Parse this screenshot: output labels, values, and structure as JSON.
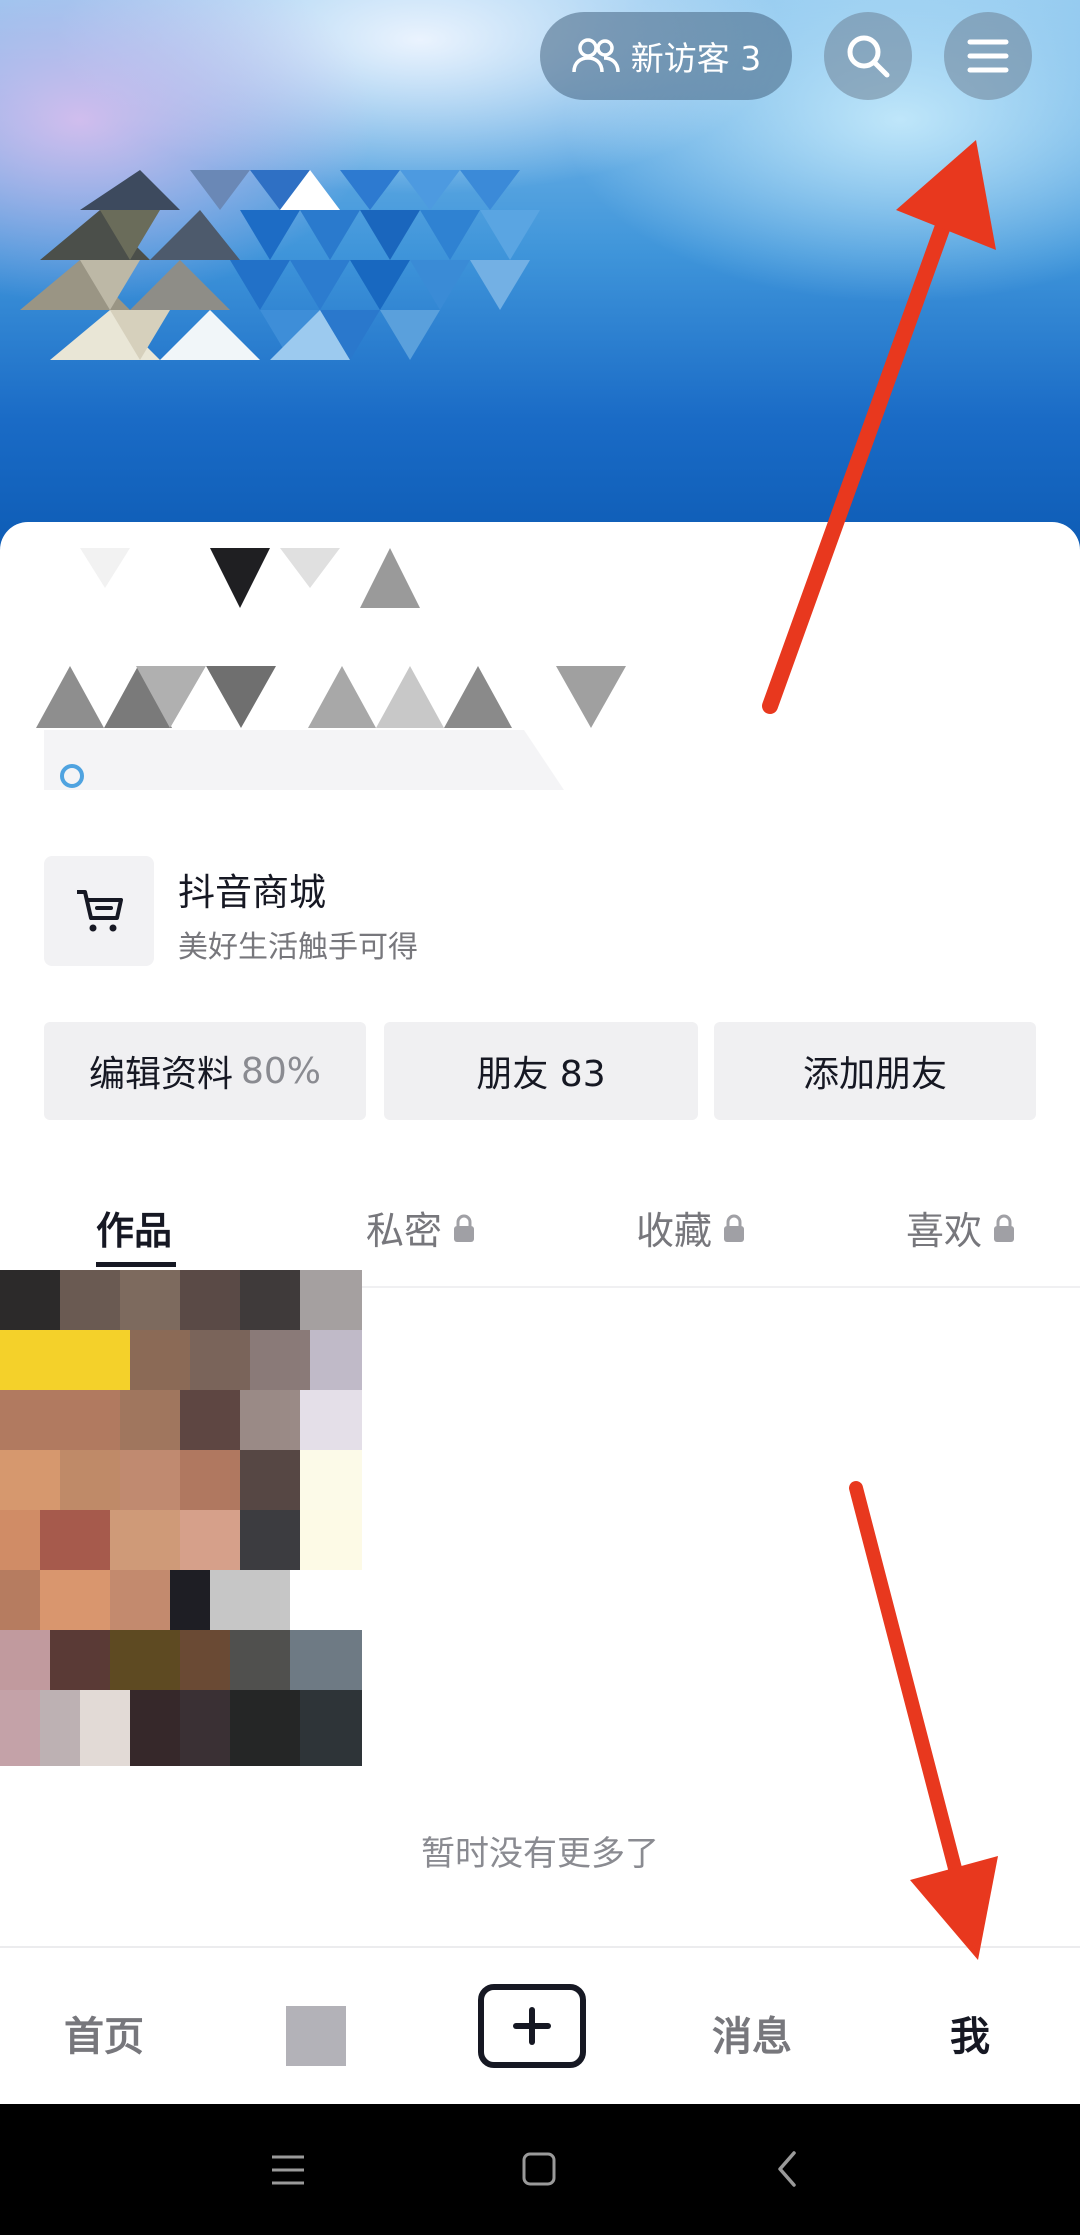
{
  "header": {
    "visitors_label": "新访客 3"
  },
  "shop": {
    "title": "抖音商城",
    "subtitle": "美好生活触手可得"
  },
  "actions": {
    "edit_label": "编辑资料",
    "edit_percent": "80%",
    "friends_label": "朋友 83",
    "add_friend_label": "添加朋友"
  },
  "tabs": [
    {
      "label": "作品",
      "locked": false
    },
    {
      "label": "私密",
      "locked": true
    },
    {
      "label": "收藏",
      "locked": true
    },
    {
      "label": "喜欢",
      "locked": true
    }
  ],
  "empty_text": "暂时没有更多了",
  "nav": {
    "home": "首页",
    "messages": "消息",
    "me": "我"
  },
  "colors": {
    "accent_red": "#e8381e",
    "text_primary": "#161823",
    "text_secondary": "#77777c"
  }
}
